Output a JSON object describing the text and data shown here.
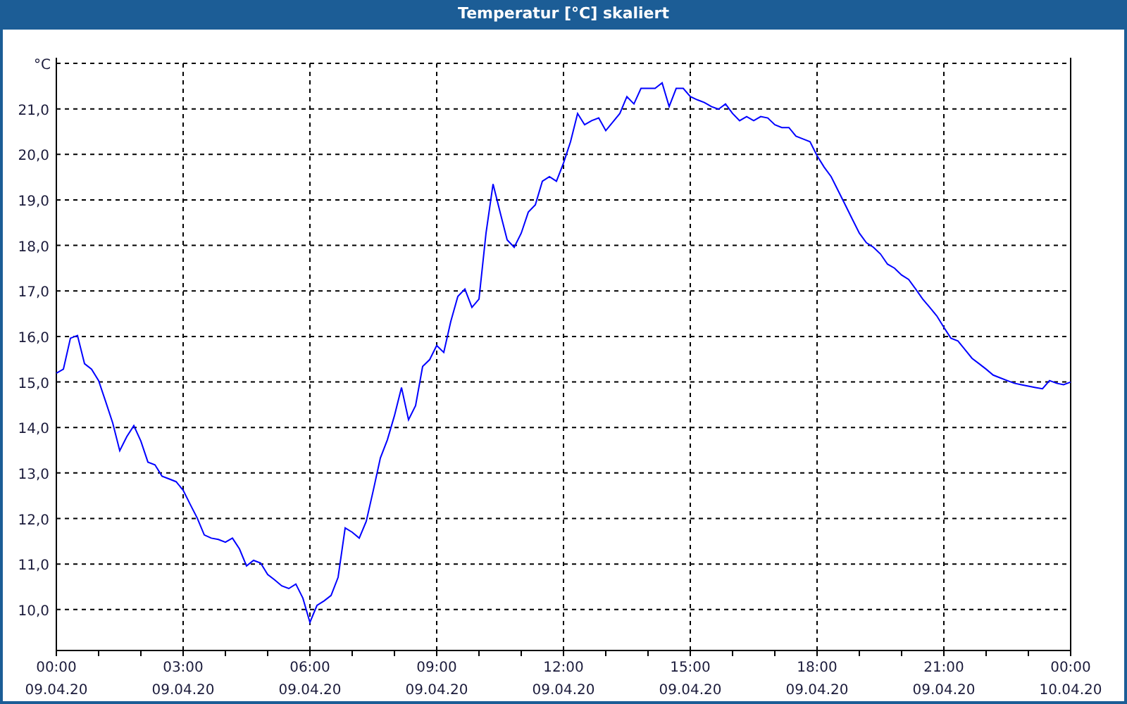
{
  "window": {
    "title": "Temperatur [°C] skaliert"
  },
  "chart": {
    "chart_data": {
      "type": "line",
      "grid": true,
      "ylabel": "°C",
      "ylim": [
        9.1,
        22
      ],
      "categories": [
        "00:00\n09.04.20",
        null,
        null,
        null,
        null,
        null,
        null,
        null,
        null,
        null,
        null,
        null,
        null,
        null,
        null,
        null,
        null,
        null,
        "03:00\n09.04.20",
        null,
        null,
        null,
        null,
        null,
        null,
        null,
        null,
        null,
        null,
        null,
        null,
        null,
        null,
        null,
        null,
        null,
        "06:00\n09.04.20",
        null,
        null,
        null,
        null,
        null,
        null,
        null,
        null,
        null,
        null,
        null,
        null,
        null,
        null,
        null,
        null,
        null,
        "09:00\n09.04.20",
        null,
        null,
        null,
        null,
        null,
        null,
        null,
        null,
        null,
        null,
        null,
        null,
        null,
        null,
        null,
        null,
        null,
        "12:00\n09.04.20",
        null,
        null,
        null,
        null,
        null,
        null,
        null,
        null,
        null,
        null,
        null,
        null,
        null,
        null,
        null,
        null,
        null,
        "15:00\n09.04.20",
        null,
        null,
        null,
        null,
        null,
        null,
        null,
        null,
        null,
        null,
        null,
        null,
        null,
        null,
        null,
        null,
        null,
        "18:00\n09.04.20",
        null,
        null,
        null,
        null,
        null,
        null,
        null,
        null,
        null,
        null,
        null,
        null,
        null,
        null,
        null,
        null,
        null,
        "21:00\n09.04.20",
        null,
        null,
        null,
        null,
        null,
        null,
        null,
        null,
        null,
        null,
        null,
        null,
        null,
        null,
        null,
        null,
        null,
        "00:00\n10.04.20"
      ],
      "series": [
        {
          "color": "#0000ff",
          "values": [
            15.19,
            15.28,
            15.96,
            16.02,
            15.4,
            15.28,
            15.03,
            14.57,
            14.1,
            13.49,
            13.8,
            14.04,
            13.7,
            13.24,
            13.18,
            12.93,
            12.87,
            12.81,
            12.62,
            12.31,
            12.01,
            11.64,
            11.57,
            11.54,
            11.48,
            11.57,
            11.33,
            10.96,
            11.08,
            11.02,
            10.77,
            10.65,
            10.52,
            10.46,
            10.56,
            10.25,
            9.72,
            10.09,
            10.19,
            10.31,
            10.71,
            11.79,
            11.7,
            11.57,
            11.94,
            12.62,
            13.33,
            13.73,
            14.26,
            14.88,
            14.17,
            14.48,
            15.34,
            15.49,
            15.8,
            15.65,
            16.33,
            16.88,
            17.04,
            16.64,
            16.82,
            18.27,
            19.35,
            18.73,
            18.12,
            17.96,
            18.27,
            18.73,
            18.89,
            19.41,
            19.51,
            19.41,
            19.81,
            20.28,
            20.9,
            20.65,
            20.74,
            20.8,
            20.52,
            20.71,
            20.9,
            21.27,
            21.11,
            21.45,
            21.45,
            21.45,
            21.57,
            21.05,
            21.45,
            21.45,
            21.27,
            21.2,
            21.14,
            21.05,
            20.99,
            21.11,
            20.9,
            20.74,
            20.83,
            20.74,
            20.83,
            20.8,
            20.65,
            20.59,
            20.59,
            20.4,
            20.34,
            20.28,
            19.97,
            19.72,
            19.51,
            19.2,
            18.89,
            18.58,
            18.27,
            18.06,
            17.96,
            17.81,
            17.59,
            17.5,
            17.35,
            17.25,
            17.04,
            16.82,
            16.64,
            16.45,
            16.2,
            15.96,
            15.9,
            15.71,
            15.52,
            15.4,
            15.28,
            15.15,
            15.09,
            15.03,
            14.97,
            14.94,
            14.91,
            14.88,
            14.85,
            15.03,
            14.97,
            14.94,
            15.0
          ]
        }
      ],
      "yticks": [
        {
          "value": 10,
          "label": "10,0"
        },
        {
          "value": 11,
          "label": "11,0"
        },
        {
          "value": 12,
          "label": "12,0"
        },
        {
          "value": 13,
          "label": "13,0"
        },
        {
          "value": 14,
          "label": "14,0"
        },
        {
          "value": 15,
          "label": "15,0"
        },
        {
          "value": 16,
          "label": "16,0"
        },
        {
          "value": 17,
          "label": "17,0"
        },
        {
          "value": 18,
          "label": "18,0"
        },
        {
          "value": 19,
          "label": "19,0"
        },
        {
          "value": 20,
          "label": "20,0"
        },
        {
          "value": 21,
          "label": "21,0"
        }
      ]
    }
  }
}
